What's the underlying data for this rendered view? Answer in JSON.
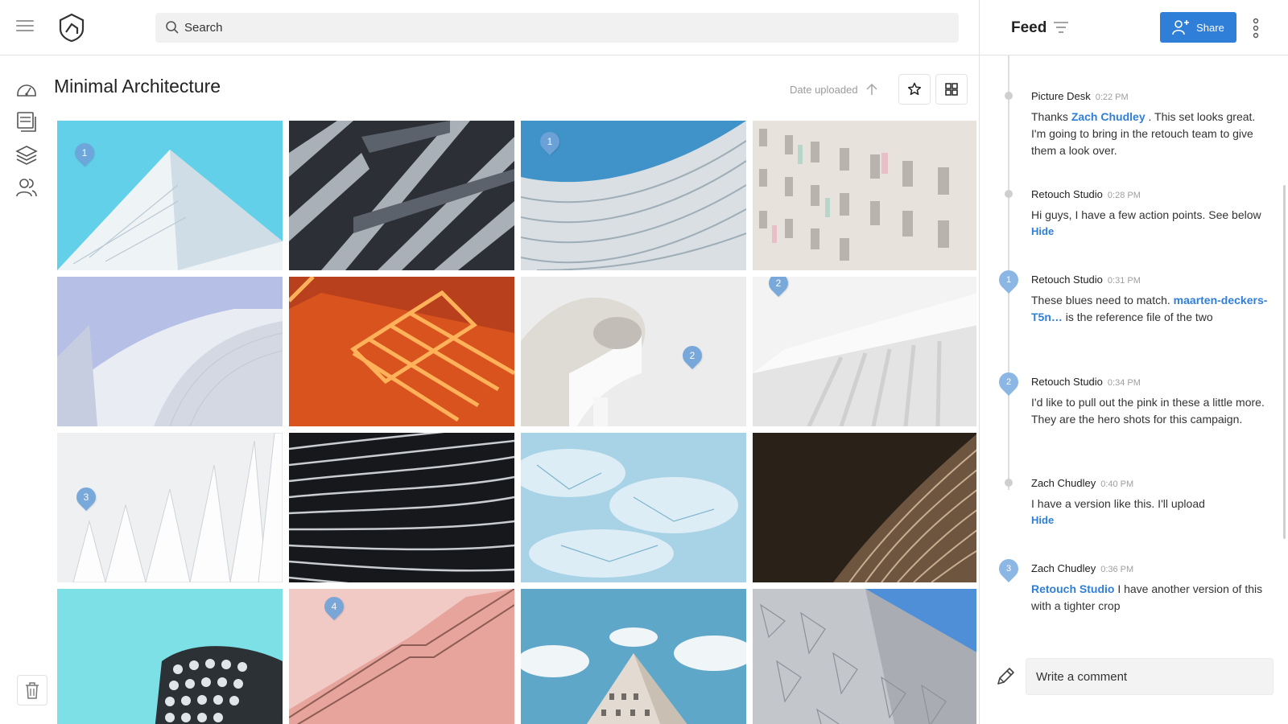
{
  "app": {
    "menu_icon": "hamburger-menu-icon",
    "logo_icon": "shield-house-logo-icon"
  },
  "search": {
    "placeholder": "Search",
    "value": ""
  },
  "rail": {
    "items": [
      "dashboard-icon",
      "images-icon",
      "layers-icon",
      "users-icon"
    ],
    "trash_icon": "trash-icon"
  },
  "main": {
    "title": "Minimal Architecture",
    "sort_label": "Date uploaded",
    "sort_icon": "arrow-up-icon",
    "star_icon": "star-icon",
    "grid_icon": "grid-view-icon"
  },
  "grid": {
    "tiles": [
      {
        "name": "white-pyramid-on-cyan",
        "pins": [
          "1"
        ]
      },
      {
        "name": "dark-diagonal-slats",
        "pins": []
      },
      {
        "name": "wavy-facade-blue-sky",
        "pins": [
          "1"
        ]
      },
      {
        "name": "pastel-window-grid",
        "pins": []
      },
      {
        "name": "curved-metal-building",
        "pins": []
      },
      {
        "name": "orange-neon-stairs",
        "pins": []
      },
      {
        "name": "white-curved-balconies",
        "pins": [
          "2"
        ]
      },
      {
        "name": "white-wall-shadows",
        "pins": [
          "2"
        ]
      },
      {
        "name": "white-fins-structure",
        "pins": [
          "3"
        ]
      },
      {
        "name": "black-wavy-stripes",
        "pins": []
      },
      {
        "name": "reflective-sky-glass",
        "pins": []
      },
      {
        "name": "brown-curved-lines",
        "pins": []
      },
      {
        "name": "checker-tower-cyan",
        "pins": []
      },
      {
        "name": "pink-stair-rail",
        "pins": [
          "4"
        ]
      },
      {
        "name": "tower-corner-sky",
        "pins": []
      },
      {
        "name": "geometric-tile-facade",
        "pins": []
      }
    ]
  },
  "feed": {
    "title": "Feed",
    "filter_icon": "filter-icon",
    "share_label": "Share",
    "share_icon": "add-person-icon",
    "more_icon": "more-vertical-icon",
    "entries": [
      {
        "author": "Picture Desk",
        "time": "0:22 PM",
        "marker": "",
        "msg_pre": "Thanks ",
        "mention": "Zach Chudley",
        "msg_post": " . This set looks great. I'm going to bring in the retouch team to give them a look over.",
        "hide": ""
      },
      {
        "author": "Retouch Studio",
        "time": "0:28 PM",
        "marker": "",
        "msg_pre": "Hi guys, I have a few action points. See below",
        "mention": "",
        "msg_post": "",
        "hide": "Hide"
      },
      {
        "author": "Retouch Studio",
        "time": "0:31 PM",
        "marker": "1",
        "msg_pre": "These blues need to match. ",
        "mention": "maarten-deckers-T5n…",
        "msg_post": " is the reference file of the two",
        "hide": ""
      },
      {
        "author": "Retouch Studio",
        "time": "0:34 PM",
        "marker": "2",
        "msg_pre": "I'd like to pull out the pink in these a little more. They are the hero shots for this campaign.",
        "mention": "",
        "msg_post": "",
        "hide": ""
      },
      {
        "author": "Zach Chudley",
        "time": "0:40 PM",
        "marker": "",
        "msg_pre": "I have a version like this. I'll upload",
        "mention": "",
        "msg_post": "",
        "hide": "Hide"
      },
      {
        "author": "Zach Chudley",
        "time": "0:36 PM",
        "marker": "3",
        "msg_pre": "",
        "mention": "Retouch Studio",
        "msg_post": " I have another version of this with a tighter crop",
        "hide": ""
      }
    ],
    "comment_placeholder": "Write a comment",
    "pencil_icon": "pencil-icon"
  },
  "colors": {
    "accent": "#2f7fd8",
    "pin": "#6fa3d9"
  }
}
